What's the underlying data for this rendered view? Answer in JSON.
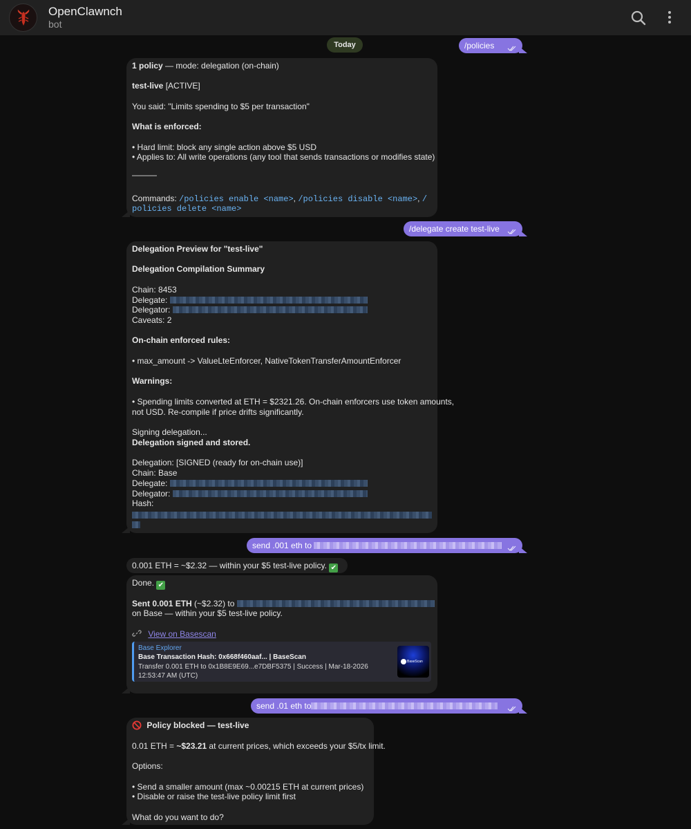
{
  "header": {
    "title": "OpenClawnch",
    "subtitle": "bot",
    "search_icon": "search-icon",
    "menu_icon": "more-vertical-icon"
  },
  "chat": {
    "date_label": "Today",
    "messages": [
      {
        "dir": "out",
        "text": "/policies"
      },
      {
        "dir": "in",
        "p1_bold": "1 policy",
        "p1_rest": " — mode: delegation (on-chain)",
        "p2_bold": "test-live",
        "p2_rest": " [ACTIVE]",
        "p3": "You said: \"Limits spending to $5 per transaction\"",
        "p4": "What is enforced:",
        "p5": "• Hard limit: block any single action above $5 USD",
        "p6": "• Applies to: All write operations (any tool that sends transactions or modifies state)",
        "p7": "———",
        "p8_prefix": "Commands: ",
        "cmd1": "/policies enable <name>",
        "sep1": ", ",
        "cmd2": "/policies disable <name>",
        "sep2": ", ",
        "cmd3a": "/",
        "cmd3b": "policies delete <name>"
      },
      {
        "dir": "out",
        "text": "/delegate create test-live"
      },
      {
        "dir": "in",
        "l1": "Delegation Preview for \"test-live\"",
        "l2": "Delegation Compilation Summary",
        "l3": "Chain: 8453",
        "l4": "Delegate: ",
        "l5": "Delegator: ",
        "l6": "Caveats: 2",
        "l7": "On-chain enforced rules:",
        "l8": "• max_amount -> ValueLteEnforcer, NativeTokenTransferAmountEnforcer",
        "l9": "Warnings:",
        "l10": "• Spending limits converted at ETH = $2321.26. On-chain enforcers use token amounts,",
        "l11": "not USD. Re-compile if price drifts significantly.",
        "l12": "Signing delegation...",
        "l13": "Delegation signed and stored.",
        "l14": "Delegation: [SIGNED (ready for on-chain use)]",
        "l15": "Chain: Base",
        "l16": "Delegate: ",
        "l17": "Delegator: ",
        "l18": "Hash:"
      },
      {
        "dir": "out",
        "text": "send .001 eth to "
      },
      {
        "dir": "in",
        "text": "0.001 ETH = ~$2.32 — within your $5 test-live policy. ",
        "emoji": "✔"
      },
      {
        "dir": "in",
        "done": "Done. ",
        "emoji": "✔",
        "sent_bold": "Sent 0.001 ETH",
        "sent_rest": " (~$2.32) to ",
        "sent_line2": "on Base — within your $5 test-live policy.",
        "link_icon": "link-icon",
        "link_text": "View on Basescan",
        "preview": {
          "site": "Base Explorer",
          "title": "Base Transaction Hash: 0x668f460aaf... | BaseScan",
          "desc": "Transfer 0.001 ETH to 0x1B8E9E69...e7DBF5375 | Success | Mar-18-2026 12:53:47 AM (UTC)",
          "thumb_label": "BaseScan"
        }
      },
      {
        "dir": "out",
        "text": "send .01 eth to"
      },
      {
        "dir": "in",
        "icon": "prohibited-icon",
        "title": "Policy blocked — test-live",
        "l1a": "0.01 ETH = ",
        "l1b": "~$23.21",
        "l1c": " at current prices, which exceeds your $5/tx limit.",
        "l2": "Options:",
        "l3": "• Send a smaller amount (max ~0.00215 ETH at current prices)",
        "l4": "• Disable or raise the test-live policy limit first",
        "l5": "What do you want to do?"
      }
    ]
  },
  "colors": {
    "background": "#0e0e0e",
    "header": "#212121",
    "bubble_in": "#212121",
    "bubble_out": "#8774e1",
    "code": "#6ab3f3",
    "link": "#8f86e8",
    "date_chip": "#2f3a22"
  }
}
